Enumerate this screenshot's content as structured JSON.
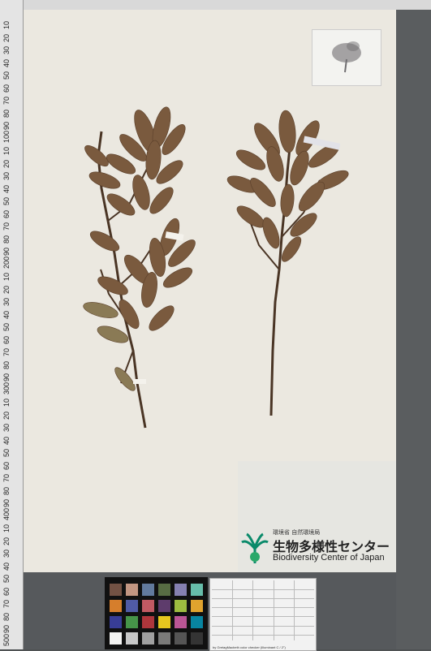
{
  "ruler": {
    "labels": [
      "10",
      "20",
      "30",
      "40",
      "50",
      "60",
      "70",
      "80",
      "90",
      "100",
      "10",
      "20",
      "30",
      "40",
      "50",
      "60",
      "70",
      "80",
      "90",
      "200",
      "10",
      "20",
      "30",
      "40",
      "50",
      "60",
      "70",
      "80",
      "90",
      "300",
      "10",
      "20",
      "30",
      "40",
      "50",
      "60",
      "70",
      "80",
      "90",
      "400",
      "10",
      "20",
      "30",
      "40",
      "50",
      "60",
      "70",
      "80",
      "90",
      "500"
    ]
  },
  "label": {
    "ministry": "環境省 自然環境局",
    "title_jp": "生物多様性センター",
    "title_en": "Biodiversity Center of Japan"
  },
  "color_chart": {
    "caption": "by GretagMacbeth color checker (Illuminant C / 2°)"
  },
  "colors": {
    "checker": [
      "#735244",
      "#c29682",
      "#627a9d",
      "#576c43",
      "#8580b1",
      "#67bdaa",
      "#d67e2c",
      "#505ba6",
      "#c15a63",
      "#5e3c6c",
      "#9dbc40",
      "#e0a32e",
      "#383d96",
      "#469449",
      "#af363c",
      "#e7c71f",
      "#bb5695",
      "#0885a1",
      "#f3f3f2",
      "#c8c8c8",
      "#a0a0a0",
      "#7a7a79",
      "#555555",
      "#343434"
    ]
  }
}
